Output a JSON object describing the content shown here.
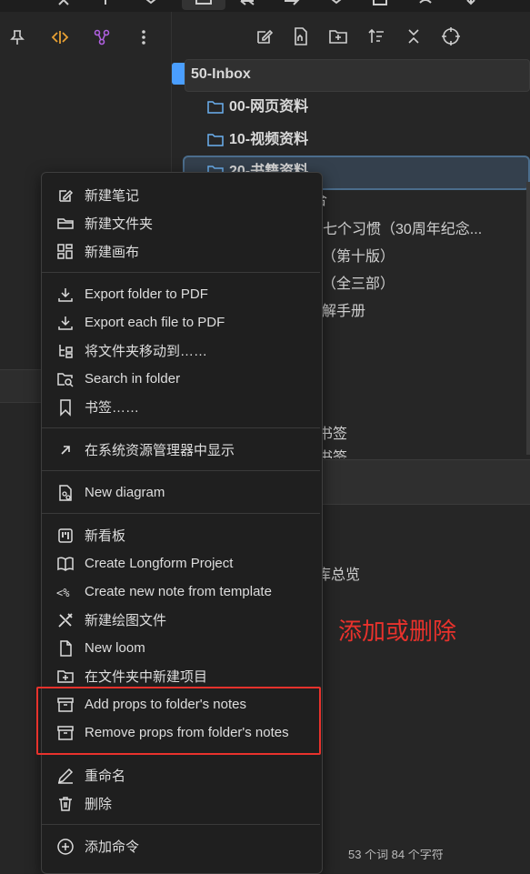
{
  "topbar": {
    "glyphs": [
      "close-icon",
      "plus-icon",
      "chevron-down-icon",
      "tab-icon",
      "swap-icon",
      "swap-alt-icon",
      "chevron-down-icon",
      "square-icon",
      "undo-icon",
      "download-icon"
    ]
  },
  "left_panel": {
    "icons": [
      "pin-icon",
      "code-icon",
      "graph-icon",
      "more-vertical-icon"
    ]
  },
  "explorer": {
    "toolbar_icons": [
      "new-note-icon",
      "new-canvas-icon",
      "new-folder-icon",
      "sort-icon",
      "collapse-icon",
      "target-icon"
    ],
    "root_folder": "50-Inbox",
    "subfolders": [
      "00-网页资料",
      "10-视频资料",
      "20-书籍资料"
    ],
    "partial_items": [
      "合",
      "士的七个习惯（30周年纪念...",
      "学（第十版）",
      "典（全三部）",
      "理解手册",
      "书签",
      "书签"
    ],
    "lower_text": "库总览"
  },
  "status_bar": {
    "text": "53 个词  84 个字符"
  },
  "annotation": {
    "text": "添加或删除",
    "color": "#e8322c"
  },
  "menu": {
    "groups": [
      [
        {
          "icon": "edit-icon",
          "label": "新建笔记"
        },
        {
          "icon": "folder-open-icon",
          "label": "新建文件夹"
        },
        {
          "icon": "canvas-icon",
          "label": "新建画布"
        }
      ],
      [
        {
          "icon": "download-icon",
          "label": "Export folder to PDF"
        },
        {
          "icon": "download-icon",
          "label": "Export each file to PDF"
        },
        {
          "icon": "folder-tree-icon",
          "label": "将文件夹移动到……"
        },
        {
          "icon": "folder-search-icon",
          "label": "Search in folder"
        },
        {
          "icon": "bookmark-icon",
          "label": "书签……"
        }
      ],
      [
        {
          "icon": "arrow-up-right-icon",
          "label": "在系统资源管理器中显示"
        }
      ],
      [
        {
          "icon": "diagram-icon",
          "label": "New diagram"
        }
      ],
      [
        {
          "icon": "kanban-icon",
          "label": "新看板"
        },
        {
          "icon": "book-open-icon",
          "label": "Create Longform Project"
        },
        {
          "icon": "template-icon",
          "label": "Create new note from template"
        },
        {
          "icon": "pen-tool-icon",
          "label": "新建绘图文件"
        },
        {
          "icon": "file-icon",
          "label": "New loom"
        },
        {
          "icon": "folder-plus-icon",
          "label": "在文件夹中新建项目"
        },
        {
          "icon": "archive-icon",
          "label": "Add props to folder's notes"
        },
        {
          "icon": "archive-icon",
          "label": "Remove props from folder's notes"
        }
      ],
      [
        {
          "icon": "pencil-icon",
          "label": "重命名"
        },
        {
          "icon": "trash-icon",
          "label": "删除"
        }
      ],
      [
        {
          "icon": "plus-circle-icon",
          "label": "添加命令"
        }
      ]
    ]
  }
}
